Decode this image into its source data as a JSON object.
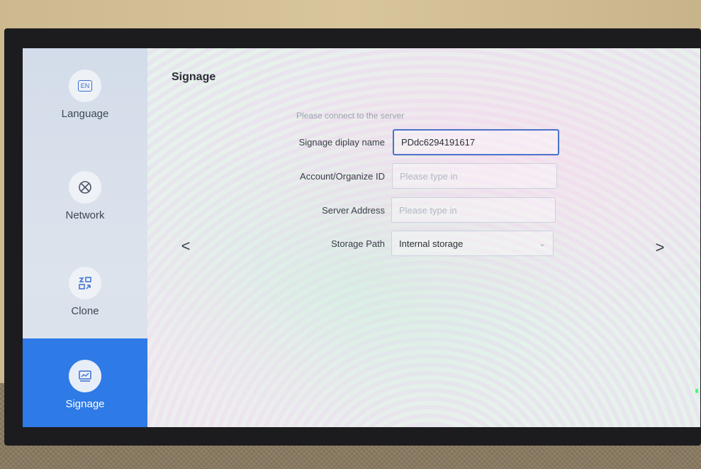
{
  "sidebar": {
    "items": [
      {
        "label": "Language",
        "icon": "language-icon",
        "icon_text": "EN"
      },
      {
        "label": "Network",
        "icon": "network-icon"
      },
      {
        "label": "Clone",
        "icon": "clone-icon"
      },
      {
        "label": "Signage",
        "icon": "signage-icon",
        "active": true
      }
    ]
  },
  "main": {
    "title": "Signage",
    "hint": "Please connect to the server",
    "fields": {
      "display_name": {
        "label": "Signage diplay name",
        "value": "PDdc6294191617"
      },
      "account_id": {
        "label": "Account/Organize ID",
        "placeholder": "Please type in"
      },
      "server_address": {
        "label": "Server Address",
        "placeholder": "Please type in"
      },
      "storage_path": {
        "label": "Storage Path",
        "value": "Internal storage"
      }
    },
    "nav": {
      "prev": "<",
      "next": ">"
    }
  },
  "colors": {
    "accent": "#2e7ae6",
    "focus_border": "#4a72c9"
  }
}
